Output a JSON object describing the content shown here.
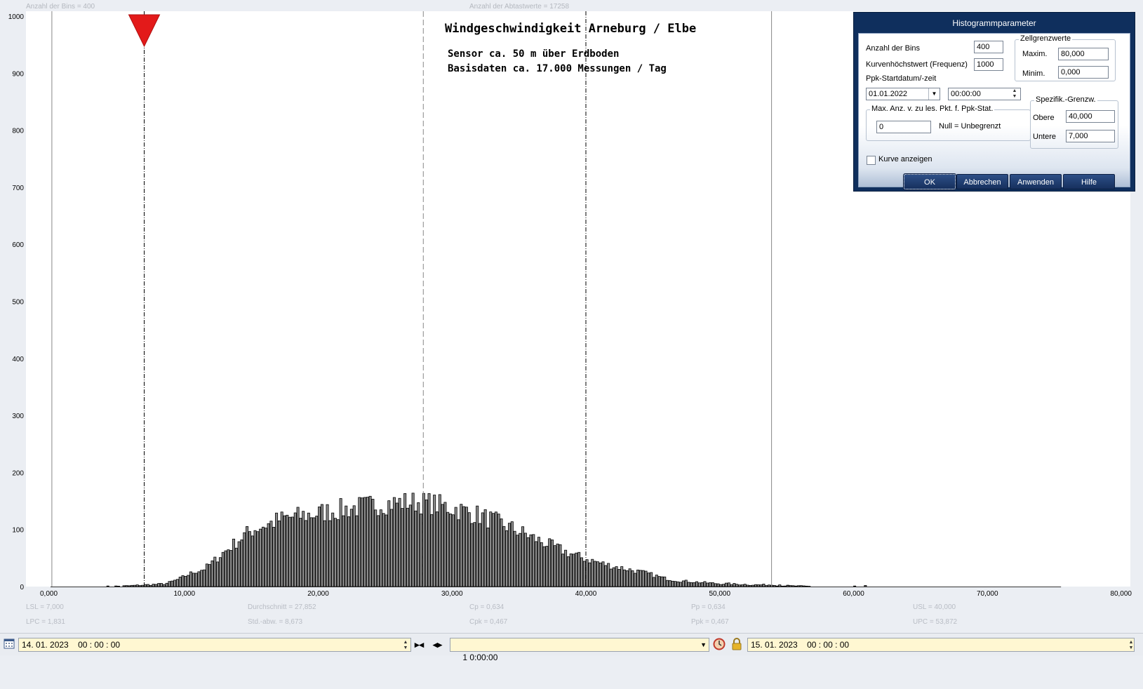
{
  "header": {
    "bins_label": "Anzahl der Bins =   400",
    "samples_label": "Anzahl der Abtastwerte = 17258"
  },
  "chart_data": {
    "type": "bar",
    "title": "Windgeschwindigkeit  Arneburg / Elbe",
    "subtitle_lines": [
      "Sensor ca. 50 m über Erdboden",
      "Basisdaten ca. 17.000 Messungen / Tag"
    ],
    "xlim": [
      0,
      80
    ],
    "ylim": [
      0,
      1000
    ],
    "x_ticks": [
      "0,000",
      "10,000",
      "20,000",
      "30,000",
      "40,000",
      "50,000",
      "60,000",
      "70,000",
      "80,000"
    ],
    "y_ticks": [
      "0",
      "100",
      "200",
      "300",
      "400",
      "500",
      "600",
      "700",
      "800",
      "900",
      "1000"
    ],
    "bin_width": 0.2,
    "vertical_lines": [
      {
        "x": 7.0,
        "style": "dash-dot",
        "name": "LSL"
      },
      {
        "x": 27.852,
        "style": "dashed",
        "name": "mean"
      },
      {
        "x": 40.0,
        "style": "dash-dot",
        "name": "USL"
      },
      {
        "x": 53.872,
        "style": "solid",
        "name": "UPC"
      },
      {
        "x": 0.1,
        "style": "solid",
        "name": "axis-left"
      }
    ],
    "marker": {
      "x": 7.0,
      "color": "#e31a1a"
    },
    "profile_points": [
      [
        4.0,
        0
      ],
      [
        5.6,
        1
      ],
      [
        6.4,
        2
      ],
      [
        7.2,
        3
      ],
      [
        8.0,
        4
      ],
      [
        8.6,
        5
      ],
      [
        9.0,
        8
      ],
      [
        9.6,
        13
      ],
      [
        10.2,
        20
      ],
      [
        10.8,
        26
      ],
      [
        11.4,
        30
      ],
      [
        11.8,
        36
      ],
      [
        12.4,
        48
      ],
      [
        12.8,
        57
      ],
      [
        13.4,
        68
      ],
      [
        14.0,
        80
      ],
      [
        14.6,
        92
      ],
      [
        15.2,
        100
      ],
      [
        15.8,
        106
      ],
      [
        16.4,
        110
      ],
      [
        17.0,
        116
      ],
      [
        17.6,
        120
      ],
      [
        18.2,
        122
      ],
      [
        18.8,
        124
      ],
      [
        19.4,
        126
      ],
      [
        20.0,
        128
      ],
      [
        20.6,
        131
      ],
      [
        21.2,
        133
      ],
      [
        21.8,
        135
      ],
      [
        22.4,
        137
      ],
      [
        23.0,
        139
      ],
      [
        23.6,
        141
      ],
      [
        24.2,
        143
      ],
      [
        24.8,
        145
      ],
      [
        25.4,
        146
      ],
      [
        26.0,
        147
      ],
      [
        26.6,
        148
      ],
      [
        27.2,
        148
      ],
      [
        27.8,
        147
      ],
      [
        28.4,
        146
      ],
      [
        29.0,
        143
      ],
      [
        29.6,
        140
      ],
      [
        30.2,
        137
      ],
      [
        30.8,
        133
      ],
      [
        31.4,
        129
      ],
      [
        32.0,
        125
      ],
      [
        32.6,
        120
      ],
      [
        33.2,
        115
      ],
      [
        33.8,
        109
      ],
      [
        34.4,
        103
      ],
      [
        35.0,
        97
      ],
      [
        35.6,
        91
      ],
      [
        36.2,
        84
      ],
      [
        36.8,
        78
      ],
      [
        37.4,
        72
      ],
      [
        38.0,
        66
      ],
      [
        38.6,
        60
      ],
      [
        39.2,
        55
      ],
      [
        39.8,
        50
      ],
      [
        40.4,
        46
      ],
      [
        41.0,
        42
      ],
      [
        41.6,
        38
      ],
      [
        42.2,
        35
      ],
      [
        42.8,
        32
      ],
      [
        43.4,
        29
      ],
      [
        44.0,
        26
      ],
      [
        44.6,
        23
      ],
      [
        45.2,
        19
      ],
      [
        45.8,
        15
      ],
      [
        46.4,
        12
      ],
      [
        47.0,
        10
      ],
      [
        47.6,
        9
      ],
      [
        48.2,
        8
      ],
      [
        48.8,
        7
      ],
      [
        49.4,
        6
      ],
      [
        50.0,
        5
      ],
      [
        50.6,
        5
      ],
      [
        51.2,
        4
      ],
      [
        51.8,
        4
      ],
      [
        52.4,
        3
      ],
      [
        53.0,
        3
      ],
      [
        53.8,
        3
      ],
      [
        54.6,
        2
      ],
      [
        55.4,
        1
      ],
      [
        56.4,
        0.5
      ],
      [
        58.0,
        0
      ]
    ],
    "extra_bars": [
      [
        54.0,
        2
      ],
      [
        54.4,
        3
      ],
      [
        55.0,
        2
      ],
      [
        55.6,
        1
      ],
      [
        60.0,
        1
      ],
      [
        60.8,
        2
      ]
    ],
    "seed": 7
  },
  "stats": {
    "lsl": "LSL = 7,000",
    "lpc": "LPC = 1,831",
    "mean": "Durchschnitt  = 27,852",
    "std": "Std.-abw. = 8,673",
    "cp": "Cp  = 0,634",
    "cpk": "Cpk = 0,467",
    "pp": "Pp  = 0,634",
    "ppk": "Ppk = 0,467",
    "usl": "USL = 40,000",
    "upc": "UPC = 53,872"
  },
  "dialog": {
    "title": "Histogrammparameter",
    "bins_label": "Anzahl der Bins",
    "bins_value": "400",
    "curve_max_label": "Kurvenhöchstwert (Frequenz)",
    "curve_max_value": "1000",
    "ppk_start_label": "Ppk-Startdatum/-zeit",
    "start_date": "01.01.2022",
    "start_time": "00:00:00",
    "cell_limits_group": "Zellgrenzwerte",
    "max_label": "Maxim.",
    "max_value": "80,000",
    "min_label": "Minim.",
    "min_value": "0,000",
    "maxpts_group": "Max. Anz. v. zu les. Pkt. f. Ppk-Stat.",
    "maxpts_value": "0",
    "maxpts_hint": "Null = Unbegrenzt",
    "spec_group": "Spezifik.-Grenzw.",
    "upper_label": "Obere",
    "upper_value": "40,000",
    "lower_label": "Untere",
    "lower_value": "7,000",
    "show_curve_label": "Kurve anzeigen",
    "show_curve_checked": false,
    "ok": "OK",
    "cancel": "Abbrechen",
    "apply": "Anwenden",
    "help": "Hilfe"
  },
  "toolbar": {
    "start_datetime": "14. 01. 2023    00 : 00 : 00",
    "interval": "1 0:00:00",
    "end_datetime": "15. 01. 2023    00 : 00 : 00"
  }
}
